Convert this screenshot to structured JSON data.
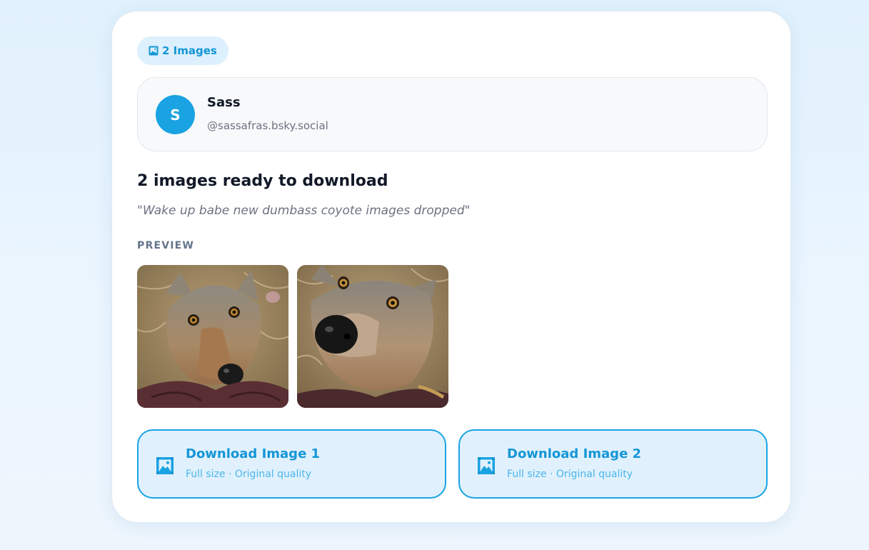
{
  "badge": {
    "icon": "framed-picture-icon",
    "label": "2 Images"
  },
  "author": {
    "avatar_initial": "S",
    "name": "Sass",
    "handle": "@sassafras.bsky.social"
  },
  "headline": "2 images ready to download",
  "quote": "\"Wake up babe new dumbass coyote images dropped\"",
  "preview_label": "PREVIEW",
  "downloads": [
    {
      "icon": "framed-picture-icon",
      "title": "Download Image 1",
      "subtitle": "Full size · Original quality"
    },
    {
      "icon": "framed-picture-icon",
      "title": "Download Image 2",
      "subtitle": "Full size · Original quality"
    }
  ],
  "colors": {
    "accent": "#1aa3e2",
    "accent_text": "#1496d6",
    "badge_bg": "#dcf0fd",
    "button_bg": "#e0f1fd"
  }
}
